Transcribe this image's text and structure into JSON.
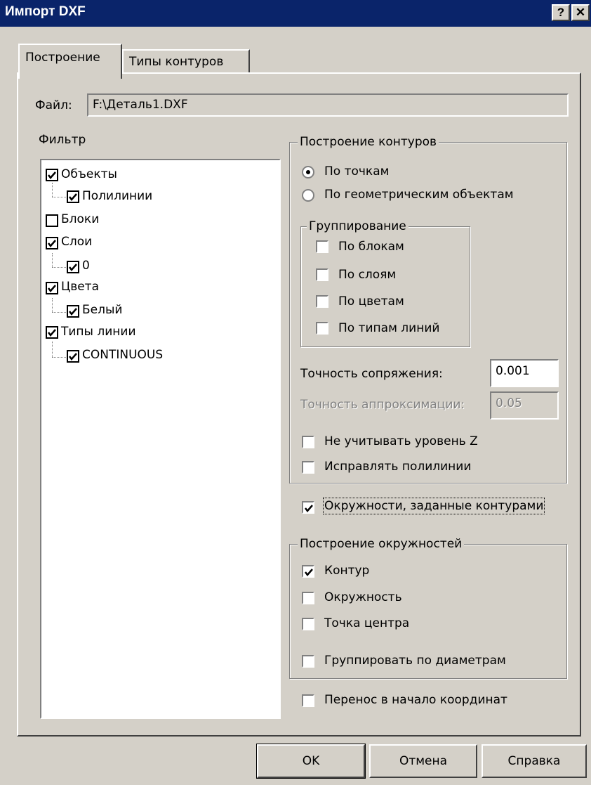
{
  "window": {
    "title": "Импорт DXF",
    "help_btn": "?",
    "close_btn": "✕"
  },
  "tabs": [
    {
      "label": "Построение",
      "active": true
    },
    {
      "label": "Типы контуров",
      "active": false
    }
  ],
  "file": {
    "label": "Файл:",
    "value": "F:\\Деталь1.DXF"
  },
  "filter": {
    "label": "Фильтр",
    "items": [
      {
        "label": "Объекты",
        "checked": true,
        "level": 0
      },
      {
        "label": "Полилинии",
        "checked": true,
        "level": 1
      },
      {
        "label": "Блоки",
        "checked": false,
        "level": 0
      },
      {
        "label": "Слои",
        "checked": true,
        "level": 0
      },
      {
        "label": "0",
        "checked": true,
        "level": 1
      },
      {
        "label": "Цвета",
        "checked": true,
        "level": 0
      },
      {
        "label": "Белый",
        "checked": true,
        "level": 1
      },
      {
        "label": "Типы линии",
        "checked": true,
        "level": 0
      },
      {
        "label": "CONTINUOUS",
        "checked": true,
        "level": 1
      }
    ]
  },
  "contours": {
    "legend": "Построение контуров",
    "radio_points": "По точкам",
    "radio_geometry": "По геометрическим объектам",
    "selected": "points",
    "grouping": {
      "legend": "Группирование",
      "blocks": "По блокам",
      "layers": "По слоям",
      "colors": "По цветам",
      "linetypes": "По типам линий"
    },
    "conj_precision_label": "Точность сопряжения:",
    "conj_precision_value": "0.001",
    "approx_precision_label": "Точность аппроксимации:",
    "approx_precision_value": "0.05",
    "ignore_z": "Не учитывать уровень Z",
    "fix_polylines": "Исправлять полилинии"
  },
  "circles_by_contours": {
    "label": "Окружности, заданные контурами",
    "checked": true
  },
  "circles": {
    "legend": "Построение окружностей",
    "contour": {
      "label": "Контур",
      "checked": true
    },
    "circle": {
      "label": "Окружность",
      "checked": false
    },
    "center": {
      "label": "Точка центра",
      "checked": false
    },
    "group_diam": {
      "label": "Группировать по диаметрам",
      "checked": false
    }
  },
  "move_origin": {
    "label": "Перенос в начало координат",
    "checked": false
  },
  "buttons": {
    "ok": "OK",
    "cancel": "Отмена",
    "help": "Справка"
  }
}
